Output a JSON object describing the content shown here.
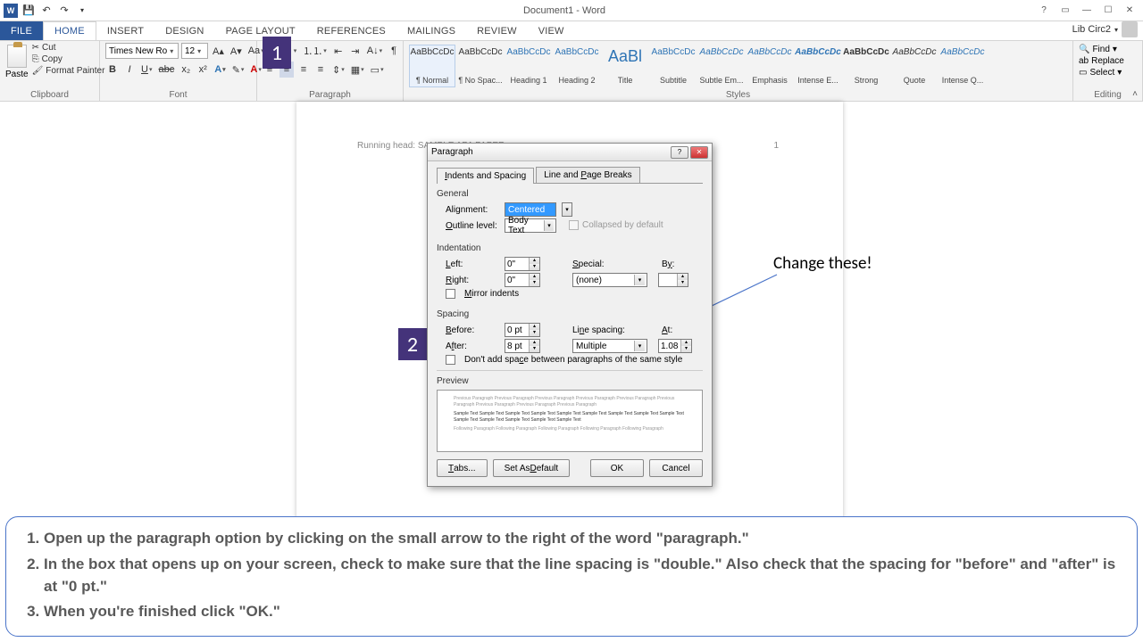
{
  "title_bar": {
    "doc_title": "Document1 - Word",
    "user": "Lib Circ2"
  },
  "tabs": {
    "file": "FILE",
    "home": "HOME",
    "insert": "INSERT",
    "design": "DESIGN",
    "page_layout": "PAGE LAYOUT",
    "references": "REFERENCES",
    "mailings": "MAILINGS",
    "review": "REVIEW",
    "view": "VIEW"
  },
  "clipboard": {
    "paste": "Paste",
    "cut": "Cut",
    "copy": "Copy",
    "painter": "Format Painter",
    "label": "Clipboard"
  },
  "font": {
    "name": "Times New Ro",
    "size": "12",
    "label": "Font"
  },
  "paragraph": {
    "label": "Paragraph"
  },
  "styles": {
    "label": "Styles",
    "items": [
      {
        "name": "¶ Normal",
        "cls": ""
      },
      {
        "name": "¶ No Spac...",
        "cls": ""
      },
      {
        "name": "Heading 1",
        "cls": "head"
      },
      {
        "name": "Heading 2",
        "cls": "head"
      },
      {
        "name": "Title",
        "cls": "title"
      },
      {
        "name": "Subtitle",
        "cls": "head"
      },
      {
        "name": "Subtle Em...",
        "cls": "em"
      },
      {
        "name": "Emphasis",
        "cls": "em"
      },
      {
        "name": "Intense E...",
        "cls": "ie"
      },
      {
        "name": "Strong",
        "cls": "strong"
      },
      {
        "name": "Quote",
        "cls": "quote"
      },
      {
        "name": "Intense Q...",
        "cls": "iq"
      }
    ],
    "preview_text": "AaBbCcDc"
  },
  "editing": {
    "find": "Find",
    "replace": "Replace",
    "select": "Select",
    "label": "Editing"
  },
  "page": {
    "running_head": "Running head: SAMPLE APA PAPER",
    "page_num": "1"
  },
  "callouts": {
    "c1": "1",
    "c2": "2",
    "annotation": "Change these!"
  },
  "dialog": {
    "title": "Paragraph",
    "tab1": "Indents and Spacing",
    "tab2": "Line and Page Breaks",
    "general_h": "General",
    "alignment_l": "Alignment:",
    "alignment_v": "Centered",
    "outline_l": "Outline level:",
    "outline_v": "Body Text",
    "collapsed": "Collapsed by default",
    "indent_h": "Indentation",
    "left_l": "Left:",
    "left_v": "0\"",
    "right_l": "Right:",
    "right_v": "0\"",
    "special_l": "Special:",
    "special_v": "(none)",
    "by_l": "By:",
    "mirror": "Mirror indents",
    "spacing_h": "Spacing",
    "before_l": "Before:",
    "before_v": "0 pt",
    "after_l": "After:",
    "after_v": "8 pt",
    "ls_l": "Line spacing:",
    "ls_v": "Multiple",
    "at_l": "At:",
    "at_v": "1.08",
    "no_add": "Don't add space between paragraphs of the same style",
    "preview_h": "Preview",
    "prev_grey": "Previous Paragraph Previous Paragraph Previous Paragraph Previous Paragraph Previous Paragraph Previous Paragraph Previous Paragraph Previous Paragraph Previous Paragraph",
    "prev_samp": "Sample Text Sample Text Sample Text Sample Text Sample Text Sample Text Sample Text Sample Text Sample Text Sample Text Sample Text Sample Text Sample Text Sample Text",
    "prev_foll": "Following Paragraph Following Paragraph Following Paragraph Following Paragraph Following Paragraph",
    "tabs_btn": "Tabs...",
    "default_btn": "Set As Default",
    "ok_btn": "OK",
    "cancel_btn": "Cancel"
  },
  "instructions": {
    "i1": "Open up the paragraph option by clicking on the small arrow to the right of the word \"paragraph.\"",
    "i2": "In the box that opens up on your screen, check to make sure that the line spacing is \"double.\"  Also check that the spacing for \"before\" and \"after\" is at \"0 pt.\"",
    "i3": "When you're finished click \"OK.\""
  }
}
